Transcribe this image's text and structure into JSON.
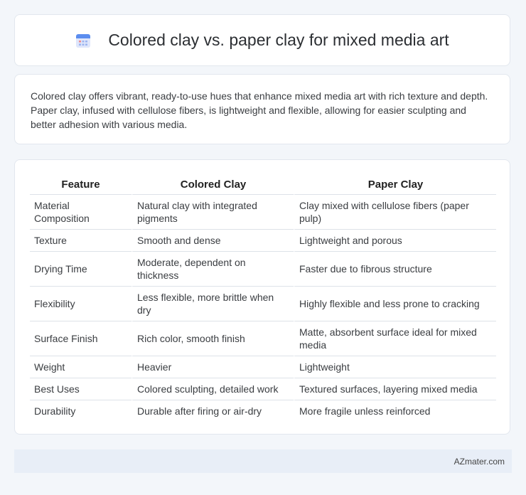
{
  "title": "Colored clay vs. paper clay for mixed media art",
  "icon": "calendar-icon",
  "intro": "Colored clay offers vibrant, ready-to-use hues that enhance mixed media art with rich texture and depth. Paper clay, infused with cellulose fibers, is lightweight and flexible, allowing for easier sculpting and better adhesion with various media.",
  "table": {
    "headers": [
      "Feature",
      "Colored Clay",
      "Paper Clay"
    ],
    "rows": [
      [
        "Material Composition",
        "Natural clay with integrated pigments",
        "Clay mixed with cellulose fibers (paper pulp)"
      ],
      [
        "Texture",
        "Smooth and dense",
        "Lightweight and porous"
      ],
      [
        "Drying Time",
        "Moderate, dependent on thickness",
        "Faster due to fibrous structure"
      ],
      [
        "Flexibility",
        "Less flexible, more brittle when dry",
        "Highly flexible and less prone to cracking"
      ],
      [
        "Surface Finish",
        "Rich color, smooth finish",
        "Matte, absorbent surface ideal for mixed media"
      ],
      [
        "Weight",
        "Heavier",
        "Lightweight"
      ],
      [
        "Best Uses",
        "Colored sculpting, detailed work",
        "Textured surfaces, layering mixed media"
      ],
      [
        "Durability",
        "Durable after firing or air-dry",
        "More fragile unless reinforced"
      ]
    ]
  },
  "footer": "AZmater.com"
}
